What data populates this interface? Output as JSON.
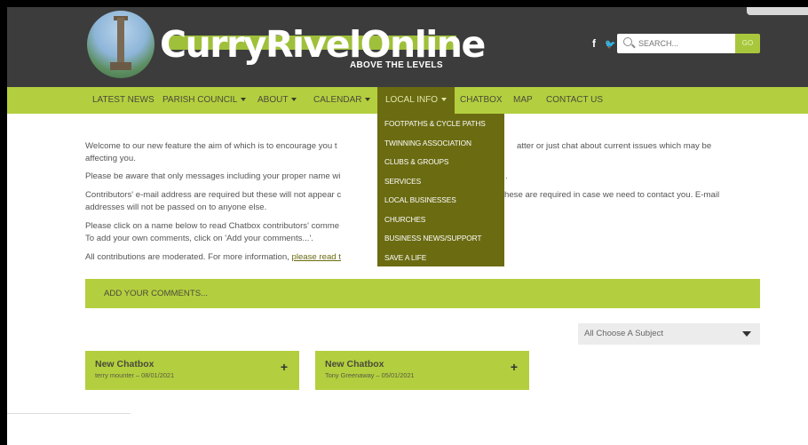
{
  "header": {
    "logo_text": "CurryRivelOnline",
    "tagline": "ABOVE THE LEVELS",
    "social": [
      "f",
      "🐦"
    ],
    "search": {
      "placeholder": "SEARCH...",
      "go_label": "GO"
    }
  },
  "nav": {
    "items": [
      {
        "label": "LATEST NEWS"
      },
      {
        "label": "PARISH COUNCIL"
      },
      {
        "label": "ABOUT"
      },
      {
        "label": "CALENDAR"
      },
      {
        "label": "LOCAL INFO"
      },
      {
        "label": "CHATBOX"
      },
      {
        "label": "MAP"
      },
      {
        "label": "CONTACT US"
      }
    ],
    "dropdown": [
      {
        "label": "FOOTPATHS & CYCLE PATHS"
      },
      {
        "label": "TWINNING ASSOCIATION"
      },
      {
        "label": "CLUBS & GROUPS"
      },
      {
        "label": "SERVICES"
      },
      {
        "label": "LOCAL BUSINESSES"
      },
      {
        "label": "CHURCHES"
      },
      {
        "label": "BUSINESS NEWS/SUPPORT"
      },
      {
        "label": "SAVE A LIFE"
      }
    ]
  },
  "content": {
    "p1a": "Welcome to our new feature the aim of which is to encourage you t",
    "p1b": "atter or just chat about current issues which may be",
    "p1c": "affecting you.",
    "p2a": "Please be aware that only messages including your proper name wi",
    "p2b": ".",
    "p3a": "Contributors' e-mail address are required but these will not appear c",
    "p3b": "hese are required in case we need to contact you. E-mail",
    "p3c": "addresses will not be passed on to anyone else.",
    "p4a": "Please click on a name below to read Chatbox contributors' comme",
    "p4b": "To add your own comments, click on 'Add your comments...'.",
    "p5a": "All contributions are moderated. For more information, ",
    "p5_link": "please read t"
  },
  "add_comments_label": "ADD YOUR COMMENTS...",
  "subject_select": {
    "value": "All Choose A Subject"
  },
  "cards": [
    {
      "title": "New Chatbox",
      "meta": "terry mounter – 08/01/2021",
      "plus": "+"
    },
    {
      "title": "New Chatbox",
      "meta": "Tony Greenaway – 05/01/2021",
      "plus": "+"
    }
  ],
  "colors": {
    "header_bg": "#3c3c3c",
    "accent": "#b3cf3f",
    "dropdown_bg": "#6b6b12"
  }
}
